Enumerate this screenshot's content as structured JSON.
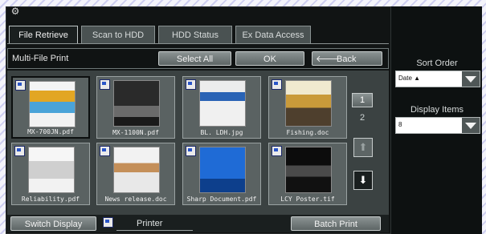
{
  "tabs": [
    {
      "label": "File Retrieve",
      "active": true
    },
    {
      "label": "Scan to HDD",
      "active": false
    },
    {
      "label": "HDD Status",
      "active": false
    },
    {
      "label": "Ex Data Access",
      "active": false
    }
  ],
  "title_bar": {
    "title": "Multi-File Print",
    "select_all_label": "Select All",
    "ok_label": "OK",
    "back_label": "Back",
    "back_arrow": "🡐"
  },
  "files": [
    {
      "name": "MX-700JN.pdf",
      "selected": true
    },
    {
      "name": "MX-1100N.pdf",
      "selected": false
    },
    {
      "name": "BL. LDH.jpg",
      "selected": false
    },
    {
      "name": "Fishing.doc",
      "selected": false
    },
    {
      "name": "Reliability.pdf",
      "selected": false
    },
    {
      "name": "News release.doc",
      "selected": false
    },
    {
      "name": "Sharp Document.pdf",
      "selected": false
    },
    {
      "name": "LCY Poster.tif",
      "selected": false
    }
  ],
  "pagination": {
    "current": "1",
    "total": "2",
    "up_arrow": "⬆",
    "down_arrow": "⬇"
  },
  "footer": {
    "switch_display_label": "Switch Display",
    "printer_label": "Printer",
    "batch_print_label": "Batch Print"
  },
  "right_panel": {
    "sort_order_label": "Sort Order",
    "sort_order_value": "Date ▲",
    "display_items_label": "Display Items",
    "display_items_value": "8"
  },
  "colors": {
    "panel_bg": "#111414",
    "content_bg": "#3b4242",
    "button_gradient_top": "#8b9393",
    "accent_blue": "#2a55c8"
  }
}
